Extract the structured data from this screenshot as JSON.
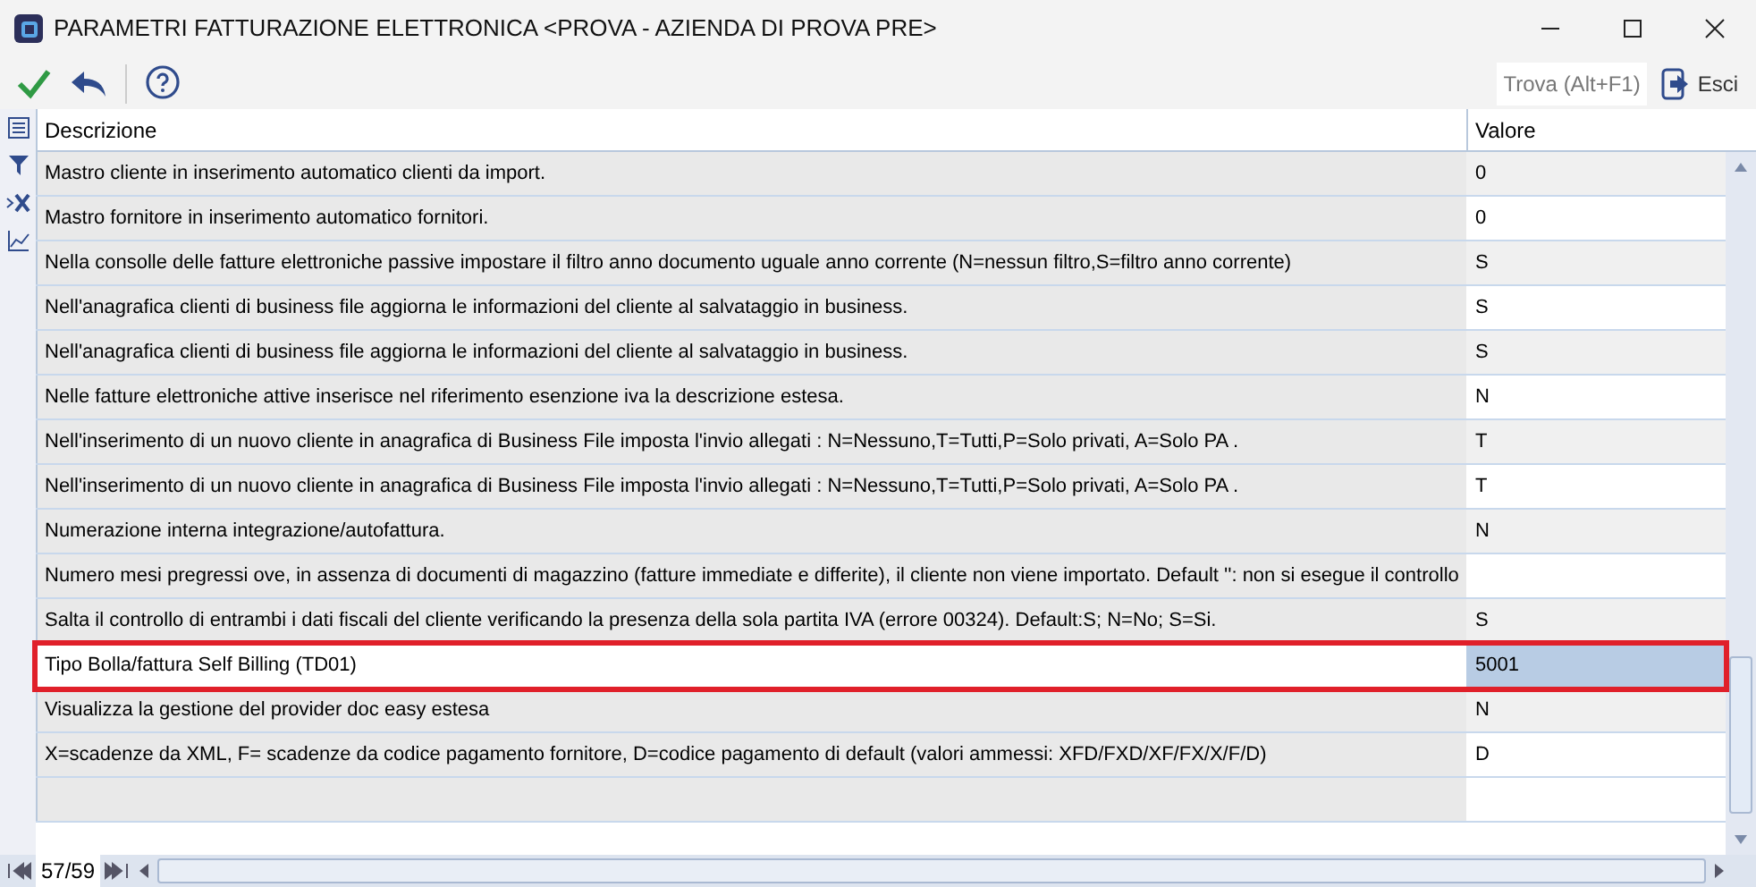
{
  "window": {
    "title": "PARAMETRI FATTURAZIONE ELETTRONICA <PROVA - AZIENDA DI PROVA PRE>"
  },
  "toolbar": {
    "search_button": "Trova (Alt+F1)",
    "exit_button": "Esci"
  },
  "table": {
    "columns": [
      "Descrizione",
      "Valore"
    ],
    "rows": [
      {
        "description": "Mastro cliente in inserimento automatico clienti da import.",
        "value": "0",
        "selected": false,
        "highlighted": false
      },
      {
        "description": "Mastro fornitore in inserimento automatico fornitori.",
        "value": "0",
        "selected": false,
        "highlighted": false
      },
      {
        "description": "Nella consolle delle fatture elettroniche passive impostare il filtro anno documento uguale anno corrente (N=nessun filtro,S=filtro anno corrente)",
        "value": "S",
        "selected": false,
        "highlighted": false
      },
      {
        "description": "Nell'anagrafica clienti di business file aggiorna le informazioni del cliente al salvataggio in business.",
        "value": "S",
        "selected": false,
        "highlighted": false
      },
      {
        "description": "Nell'anagrafica clienti di business file aggiorna le informazioni del cliente al salvataggio in business.",
        "value": "S",
        "selected": false,
        "highlighted": false
      },
      {
        "description": "Nelle fatture elettroniche attive inserisce nel riferimento esenzione iva la descrizione estesa.",
        "value": "N",
        "selected": false,
        "highlighted": false
      },
      {
        "description": "Nell'inserimento di un nuovo cliente in anagrafica di Business File imposta l'invio allegati : N=Nessuno,T=Tutti,P=Solo privati, A=Solo PA  .",
        "value": "T",
        "selected": false,
        "highlighted": false
      },
      {
        "description": "Nell'inserimento di un nuovo cliente in anagrafica di Business File imposta l'invio allegati : N=Nessuno,T=Tutti,P=Solo privati, A=Solo PA  .",
        "value": "T",
        "selected": false,
        "highlighted": false
      },
      {
        "description": "Numerazione interna integrazione/autofattura.",
        "value": "N",
        "selected": false,
        "highlighted": false
      },
      {
        "description": "Numero mesi pregressi ove, in assenza di documenti di magazzino (fatture immediate e differite), il cliente non viene importato. Default '': non si esegue il controllo",
        "value": "",
        "selected": false,
        "highlighted": false
      },
      {
        "description": "Salta il controllo di entrambi i dati fiscali del cliente verificando la presenza della sola partita IVA (errore 00324). Default:S; N=No; S=Si.",
        "value": "S",
        "selected": false,
        "highlighted": false
      },
      {
        "description": "Tipo Bolla/fattura Self Billing (TD01)",
        "value": "5001",
        "selected": true,
        "highlighted": true
      },
      {
        "description": "Visualizza la gestione del provider doc easy estesa",
        "value": "N",
        "selected": false,
        "highlighted": false
      },
      {
        "description": "X=scadenze da XML, F= scadenze da codice pagamento fornitore, D=codice pagamento di default (valori ammessi: XFD/FXD/XF/FX/X/F/D)",
        "value": "D",
        "selected": false,
        "highlighted": false
      }
    ]
  },
  "status_bar": {
    "record_counter": "57/59"
  }
}
